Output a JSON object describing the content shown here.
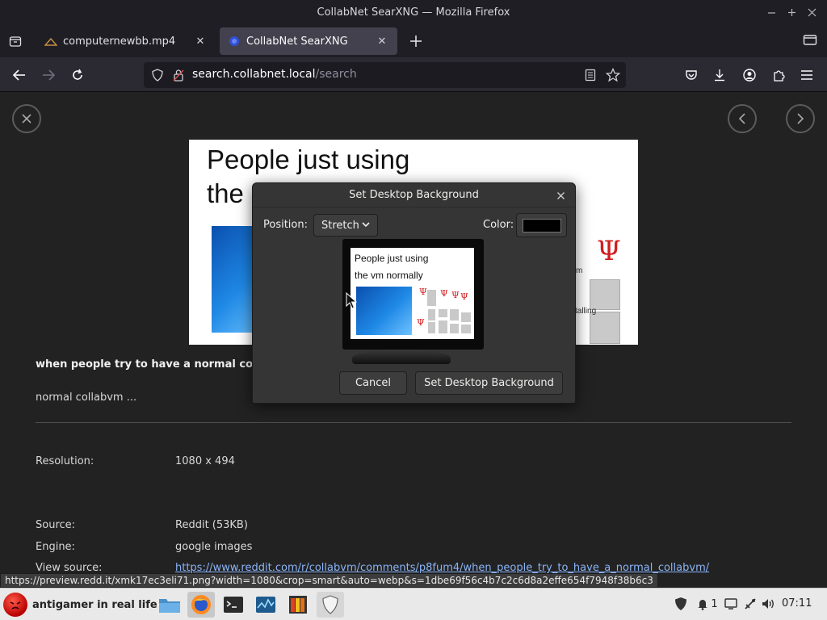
{
  "window": {
    "title": "CollabNet SearXNG — Mozilla Firefox",
    "controls": [
      "minimize",
      "maximize",
      "close"
    ]
  },
  "tabs": [
    {
      "label": "computernewbb.mp4",
      "active": false,
      "icon": "video-file-icon"
    },
    {
      "label": "CollabNet SearXNG",
      "active": true,
      "icon": "searxng-icon"
    }
  ],
  "navbar": {
    "url_host": "search.collabnet.local",
    "url_path": "/search"
  },
  "result": {
    "preview": {
      "title_line1": "People just using",
      "title_line2": "the",
      "fragment_m": "m",
      "fragment_talling": "talling"
    },
    "title": "when people try to have a normal collabv",
    "description": "normal collabvm ...",
    "meta": [
      {
        "label": "Resolution:",
        "value": "1080 x 494"
      },
      {
        "label": "Source:",
        "value": "Reddit (53KB)"
      },
      {
        "label": "Engine:",
        "value": "google images"
      },
      {
        "label": "View source:",
        "value": "https://www.reddit.com/r/collabvm/comments/p8fum4/when_people_try_to_have_a_normal_collabvm/"
      }
    ]
  },
  "dialog": {
    "title": "Set Desktop Background",
    "position_label": "Position:",
    "position_value": "Stretch",
    "color_label": "Color:",
    "color_value": "#000000",
    "preview_line1": "People just using",
    "preview_line2": "the vm normally",
    "cancel_label": "Cancel",
    "confirm_label": "Set Desktop Background"
  },
  "status_url": "https://preview.redd.it/xmk17ec3eli71.png?width=1080&crop=smart&auto=webp&s=1dbe69f56c4b7c2c6d8a2effe654f7948f38b6c3",
  "taskbar": {
    "start_label": "antigamer in real life",
    "launchers": [
      "file-manager-icon",
      "firefox-icon",
      "terminal-icon",
      "system-monitor-icon",
      "image-viewer-icon",
      "shield-icon"
    ],
    "notification_count": "1",
    "clock": "07:11"
  },
  "colors": {
    "page_bg": "#222222",
    "chrome_bg": "#1f1e25",
    "dialog_bg": "#353535",
    "link": "#8ab4f8",
    "taskbar_bg": "#e9e9e9"
  }
}
